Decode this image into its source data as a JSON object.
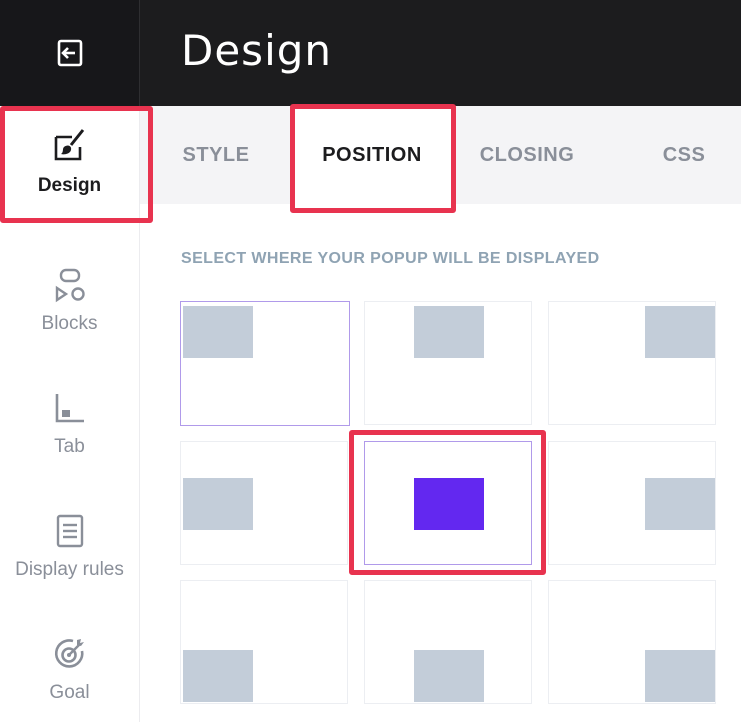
{
  "header": {
    "title": "Design",
    "back_icon": "exit-icon"
  },
  "sidebar": {
    "items": [
      {
        "label": "Design",
        "icon": "brush-edit-icon",
        "active": true
      },
      {
        "label": "Blocks",
        "icon": "blocks-icon",
        "active": false
      },
      {
        "label": "Tab",
        "icon": "tab-icon",
        "active": false
      },
      {
        "label": "Display rules",
        "icon": "display-rules-icon",
        "active": false
      },
      {
        "label": "Goal",
        "icon": "goal-icon",
        "active": false
      }
    ]
  },
  "tabs": [
    {
      "label": "STYLE",
      "active": false
    },
    {
      "label": "POSITION",
      "active": true
    },
    {
      "label": "CLOSING",
      "active": false
    },
    {
      "label": "CSS",
      "active": false
    }
  ],
  "position": {
    "instruction": "SELECT WHERE YOUR POPUP WILL BE DISPLAYED",
    "options": [
      "top-left",
      "top-center",
      "top-right",
      "middle-left",
      "center",
      "middle-right",
      "bottom-left",
      "bottom-center",
      "bottom-right"
    ],
    "selected": "center"
  },
  "colors": {
    "header_bg": "#1c1c1e",
    "accent": "#6328f0",
    "highlight": "#e8334f",
    "placeholder_block": "#c3cdd9"
  }
}
